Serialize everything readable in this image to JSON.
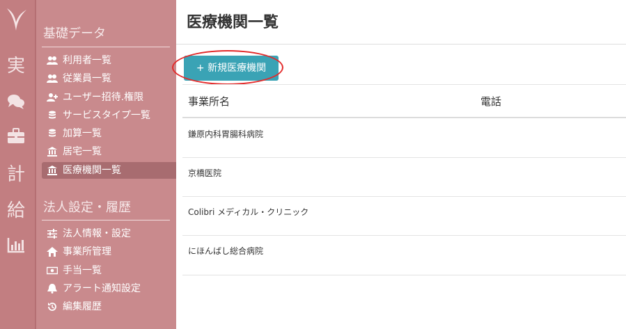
{
  "rail": {
    "items": [
      {
        "label": "実",
        "icon": ""
      },
      {
        "label": "",
        "icon": "chat-bubbles-icon"
      },
      {
        "label": "",
        "icon": "briefcase-icon"
      },
      {
        "label": "計",
        "icon": ""
      },
      {
        "label": "給",
        "icon": ""
      },
      {
        "label": "",
        "icon": "bar-chart-icon"
      }
    ]
  },
  "sidebar": {
    "section1_title": "基礎データ",
    "section1_items": [
      {
        "label": "利用者一覧",
        "icon": "users-icon"
      },
      {
        "label": "従業員一覧",
        "icon": "users-icon"
      },
      {
        "label": "ユーザー招待.権限",
        "icon": "user-plus-icon"
      },
      {
        "label": "サービスタイプ一覧",
        "icon": "database-icon"
      },
      {
        "label": "加算一覧",
        "icon": "database-icon"
      },
      {
        "label": "居宅一覧",
        "icon": "institution-icon"
      },
      {
        "label": "医療機関一覧",
        "icon": "institution-icon",
        "active": true
      }
    ],
    "section2_title": "法人設定・履歴",
    "section2_items": [
      {
        "label": "法人情報・設定",
        "icon": "sliders-icon"
      },
      {
        "label": "事業所管理",
        "icon": "home-icon"
      },
      {
        "label": "手当一覧",
        "icon": "money-icon"
      },
      {
        "label": "アラート通知設定",
        "icon": "bell-icon"
      },
      {
        "label": "編集履歴",
        "icon": "history-icon"
      }
    ]
  },
  "main": {
    "title": "医療機関一覧",
    "add_button_label": "+ 新規医療機関",
    "table": {
      "headers": [
        "事業所名",
        "電話"
      ],
      "rows": [
        {
          "name": "鎌原内科胃腸科病院",
          "phone": ""
        },
        {
          "name": "京橋医院",
          "phone": ""
        },
        {
          "name": "Colibri メディカル・クリニック",
          "phone": ""
        },
        {
          "name": "にほんばし総合病院",
          "phone": ""
        }
      ]
    }
  },
  "colors": {
    "rail_bg": "#c27e81",
    "sidebar_bg": "#c98a8d",
    "active_item_bg": "#a86c70",
    "accent_button": "#3aa3b5",
    "highlight_ring": "#e32a2a"
  }
}
